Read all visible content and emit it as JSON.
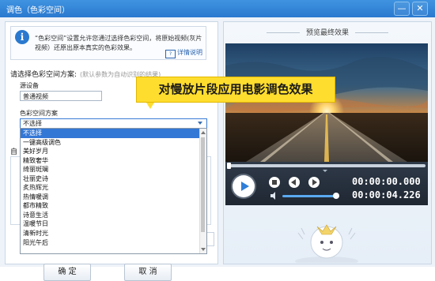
{
  "window": {
    "title": "调色（色彩空间）",
    "minimize_label": "—",
    "close_label": "✕"
  },
  "info": {
    "icon": "info-icon",
    "icon_glyph": "i",
    "text": "“色彩空间”设置允许您通过选择色彩空间，将原始视频(灰片视频）还原出原本真实的色彩效果。",
    "help_label": "详情说明"
  },
  "scheme": {
    "label": "请选择色彩空间方案:",
    "hint": "(默认参数为自动识别的结果)",
    "source_label": "源设备",
    "source_value": "普通视频",
    "color_space_label": "色彩空间方案",
    "color_space_value": "不选择",
    "options": [
      "不选择",
      "一键高级调色",
      "美好岁月",
      "精致奢华",
      "绮丽斑斓",
      "壮丽史诗",
      "炙热辉光",
      "热情暖调",
      "都市精致",
      "诗意生活",
      "温暖节日",
      "清新时光",
      "阳光午后"
    ]
  },
  "auto": {
    "label": "自"
  },
  "buttons": {
    "ok": "确 定",
    "cancel": "取 消"
  },
  "preview": {
    "label": "预览最终效果",
    "current_time": "00:00:00.000",
    "total_time": "00:00:04.226",
    "progress": 0.0,
    "volume": 0.95
  },
  "tooltip": {
    "text": "对慢放片段应用电影调色效果"
  },
  "colors": {
    "accent": "#2a79cf",
    "tooltip_bg": "#ffdd2e",
    "selected": "#3478d6"
  }
}
